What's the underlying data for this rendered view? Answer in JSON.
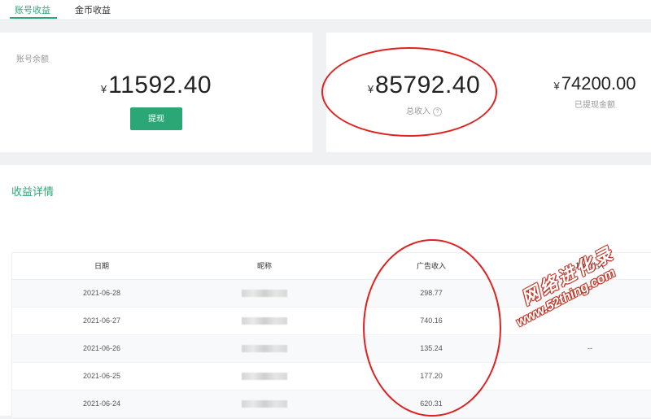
{
  "tabs": [
    {
      "label": "账号收益",
      "active": true
    },
    {
      "label": "金币收益",
      "active": false
    }
  ],
  "balance": {
    "label": "账号余额",
    "currency": "¥",
    "amount": "11592.40",
    "withdraw_button": "提现"
  },
  "income": {
    "total_currency": "¥",
    "total_amount": "85792.40",
    "total_label": "总收入",
    "help_glyph": "?",
    "withdrawn_currency": "¥",
    "withdrawn_amount": "74200.00",
    "withdrawn_label": "已提现金额"
  },
  "details": {
    "title": "收益详情",
    "columns": [
      "日期",
      "昵称",
      "广告收入",
      "其他收入"
    ],
    "rows": [
      {
        "date": "2021-06-28",
        "ad": "298.77",
        "other": ""
      },
      {
        "date": "2021-06-27",
        "ad": "740.16",
        "other": ""
      },
      {
        "date": "2021-06-26",
        "ad": "135.24",
        "other": "--"
      },
      {
        "date": "2021-06-25",
        "ad": "177.20",
        "other": ""
      },
      {
        "date": "2021-06-24",
        "ad": "620.31",
        "other": ""
      }
    ]
  },
  "watermark": {
    "cn": "网络进化录",
    "url": "www.52thing.com"
  },
  "colors": {
    "accent": "#2aa774",
    "annotation": "#e0211f",
    "background": "#f0f1f3"
  }
}
